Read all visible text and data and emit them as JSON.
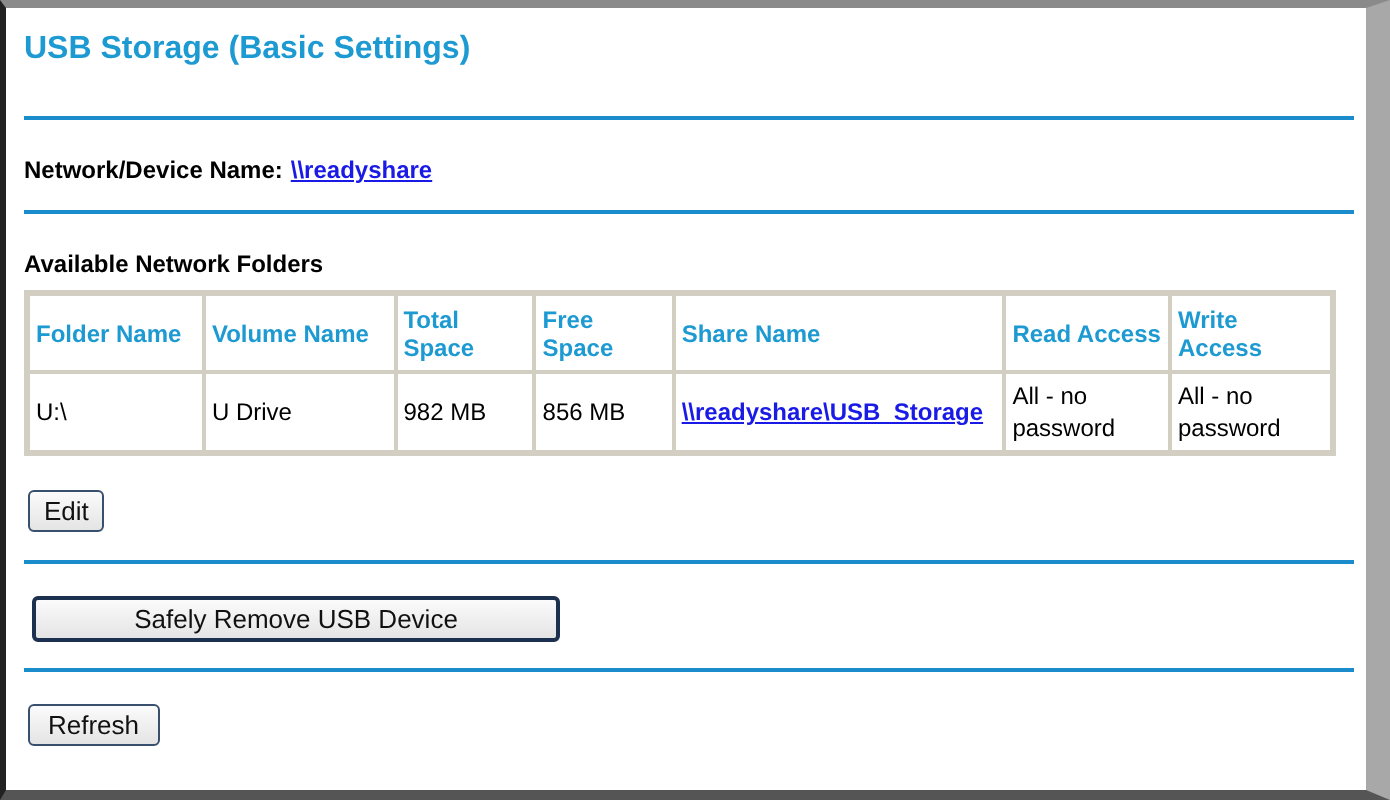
{
  "title": "USB Storage (Basic Settings)",
  "device_name": {
    "label": "Network/Device Name:",
    "link": "\\\\readyshare"
  },
  "folders": {
    "heading": "Available Network Folders",
    "columns": [
      "Folder Name",
      "Volume Name",
      "Total Space",
      "Free Space",
      "Share Name",
      "Read Access",
      "Write Access"
    ],
    "rows": [
      {
        "cells": [
          "U:\\",
          "U Drive",
          "982 MB",
          "856 MB",
          "\\\\readyshare\\USB_Storage",
          "All - no password",
          "All - no password"
        ]
      }
    ]
  },
  "buttons": [
    "Edit",
    "Safely Remove USB Device",
    "Refresh"
  ]
}
